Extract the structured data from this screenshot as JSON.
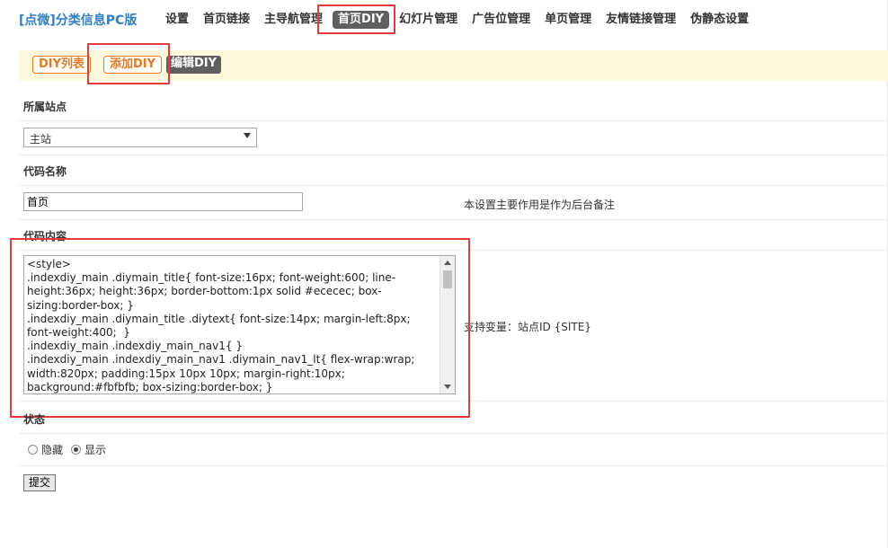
{
  "brand": "[点微]分类信息PC版",
  "nav": [
    {
      "label": "设置"
    },
    {
      "label": "首页链接"
    },
    {
      "label": "主导航管理"
    },
    {
      "label": "首页DIY",
      "active": true
    },
    {
      "label": "幻灯片管理"
    },
    {
      "label": "广告位管理"
    },
    {
      "label": "单页管理"
    },
    {
      "label": "友情链接管理"
    },
    {
      "label": "伪静态设置"
    }
  ],
  "subtabs": {
    "list": "DIY列表",
    "add": "添加DIY",
    "edit": "编辑DIY"
  },
  "form": {
    "site_label": "所属站点",
    "site_value": "主站",
    "name_label": "代码名称",
    "name_value": "首页",
    "name_hint": "本设置主要作用是作为后台备注",
    "content_label": "代码内容",
    "content_value": "<style>\n.indexdiy_main .diymain_title{ font-size:16px; font-weight:600; line-height:36px; height:36px; border-bottom:1px solid #ececec; box-sizing:border-box; }\n.indexdiy_main .diymain_title .diytext{ font-size:14px; margin-left:8px; font-weight:400;  }\n.indexdiy_main .indexdiy_main_nav1{ }\n.indexdiy_main .indexdiy_main_nav1 .diymain_nav1_lt{ flex-wrap:wrap; width:820px; padding:15px 10px 10px; margin-right:10px; background:#fbfbfb; box-sizing:border-box; }",
    "content_hint": "支持变量：站点ID {SITE}",
    "status_label": "状态",
    "status_hide": "隐藏",
    "status_show": "显示",
    "status_value": "显示",
    "submit": "提交"
  },
  "colors": {
    "brand": "#2f7fc1",
    "active_tab_bg": "#5f5f5f",
    "subbar_bg": "#fff8dc",
    "outline_tab": "#e07b2a",
    "annotation": "#e43c3c"
  }
}
